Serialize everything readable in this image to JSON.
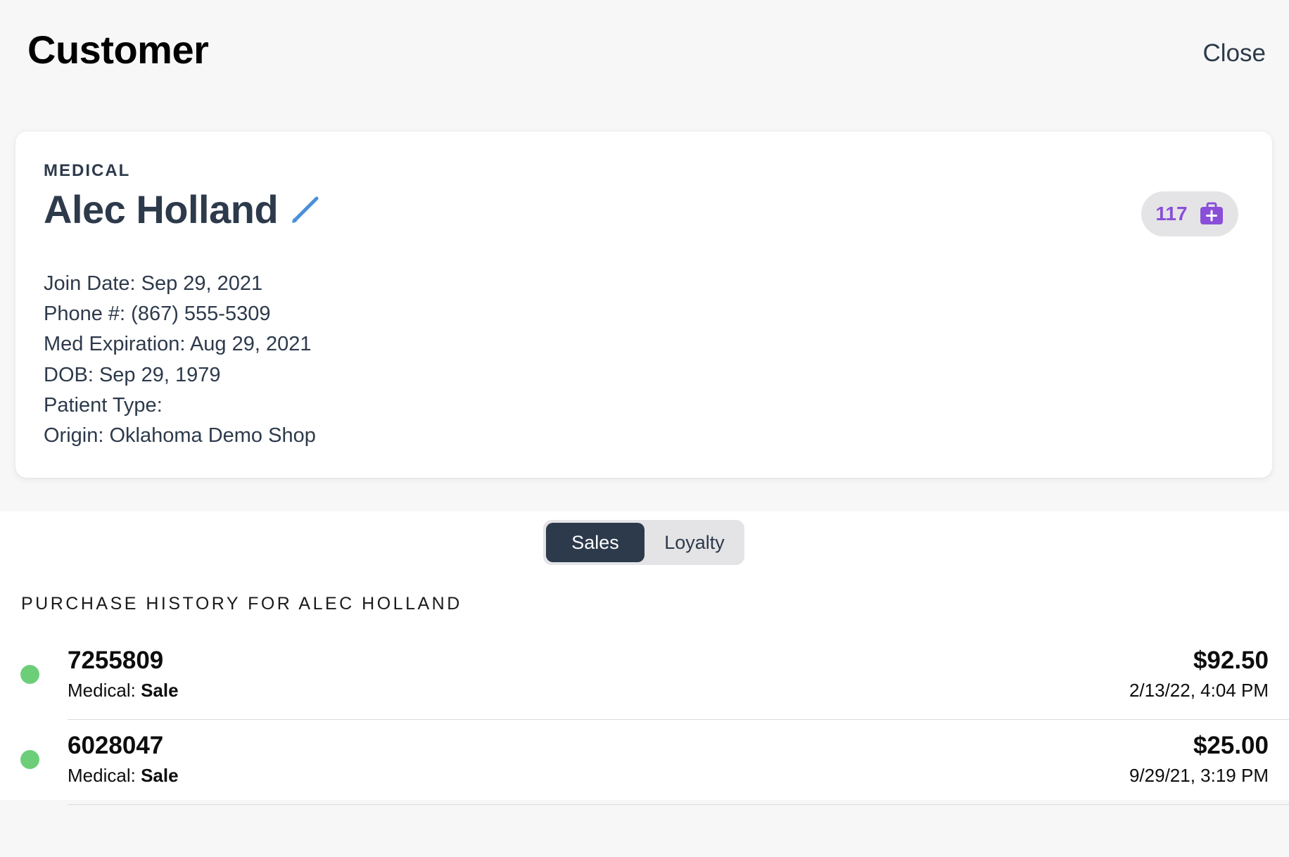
{
  "header": {
    "title": "Customer",
    "close_label": "Close"
  },
  "customer": {
    "type_label": "MEDICAL",
    "name": "Alec Holland",
    "loyalty_points": "117",
    "details": [
      "Join Date: Sep 29, 2021",
      "Phone #: (867) 555-5309",
      "Med Expiration: Aug 29, 2021",
      "DOB: Sep 29, 1979",
      "Patient Type:",
      "Origin: Oklahoma Demo Shop"
    ]
  },
  "tabs": {
    "sales_label": "Sales",
    "loyalty_label": "Loyalty",
    "active": "Sales"
  },
  "history": {
    "heading": "PURCHASE HISTORY FOR ALEC HOLLAND",
    "orders": [
      {
        "number": "7255809",
        "type_prefix": "Medical:",
        "type_value": "Sale",
        "amount": "$92.50",
        "date": "2/13/22, 4:04 PM",
        "status_color": "#6dce7a"
      },
      {
        "number": "6028047",
        "type_prefix": "Medical:",
        "type_value": "Sale",
        "amount": "$25.00",
        "date": "9/29/21, 3:19 PM",
        "status_color": "#6dce7a"
      }
    ]
  },
  "icons": {
    "edit": "pencil-icon",
    "loyalty": "medical-bag-icon"
  },
  "colors": {
    "accent_dark": "#2d3a4b",
    "loyalty_purple": "#8a4fd8",
    "edit_blue": "#4a90d9",
    "status_green": "#6dce7a"
  }
}
